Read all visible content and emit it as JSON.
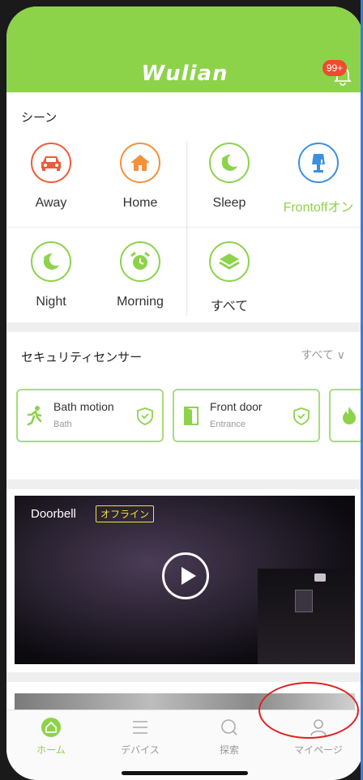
{
  "app": {
    "brand": "Wulian",
    "notification_badge": "99+"
  },
  "scenes": {
    "title": "シーン",
    "items": [
      {
        "label": "Away",
        "icon": "car-icon",
        "color": "#ef5b3a",
        "active": false
      },
      {
        "label": "Home",
        "icon": "house-icon",
        "color": "#f5913b",
        "active": false
      },
      {
        "label": "Sleep",
        "icon": "moon-icon",
        "color": "#8cd34a",
        "active": false
      },
      {
        "label": "Frontoffオン",
        "icon": "lamp-icon",
        "color": "#3d8fe0",
        "active": true
      },
      {
        "label": "Night",
        "icon": "moon-icon",
        "color": "#8cd34a",
        "active": false
      },
      {
        "label": "Morning",
        "icon": "alarm-clock-icon",
        "color": "#8cd34a",
        "active": false
      },
      {
        "label": "すべて",
        "icon": "layers-icon",
        "color": "#8cd34a",
        "active": false
      }
    ]
  },
  "security": {
    "title": "セキュリティセンサー",
    "see_all": "すべて ∨",
    "sensors": [
      {
        "name": "Bath motion",
        "room": "Bath",
        "icon": "motion-person-icon"
      },
      {
        "name": "Front door",
        "room": "Entrance",
        "icon": "door-icon"
      },
      {
        "name": "",
        "room": "",
        "icon": "fire-icon"
      }
    ]
  },
  "camera": {
    "name": "Doorbell",
    "status": "オフライン"
  },
  "tabbar": {
    "tabs": [
      {
        "label": "ホーム",
        "icon": "home-icon",
        "active": true
      },
      {
        "label": "デバイス",
        "icon": "list-icon",
        "active": false
      },
      {
        "label": "探索",
        "icon": "search-icon",
        "active": false
      },
      {
        "label": "マイページ",
        "icon": "person-icon",
        "active": false
      }
    ]
  },
  "colors": {
    "brand_green": "#8cd34a",
    "annotation_red": "#e02020"
  }
}
